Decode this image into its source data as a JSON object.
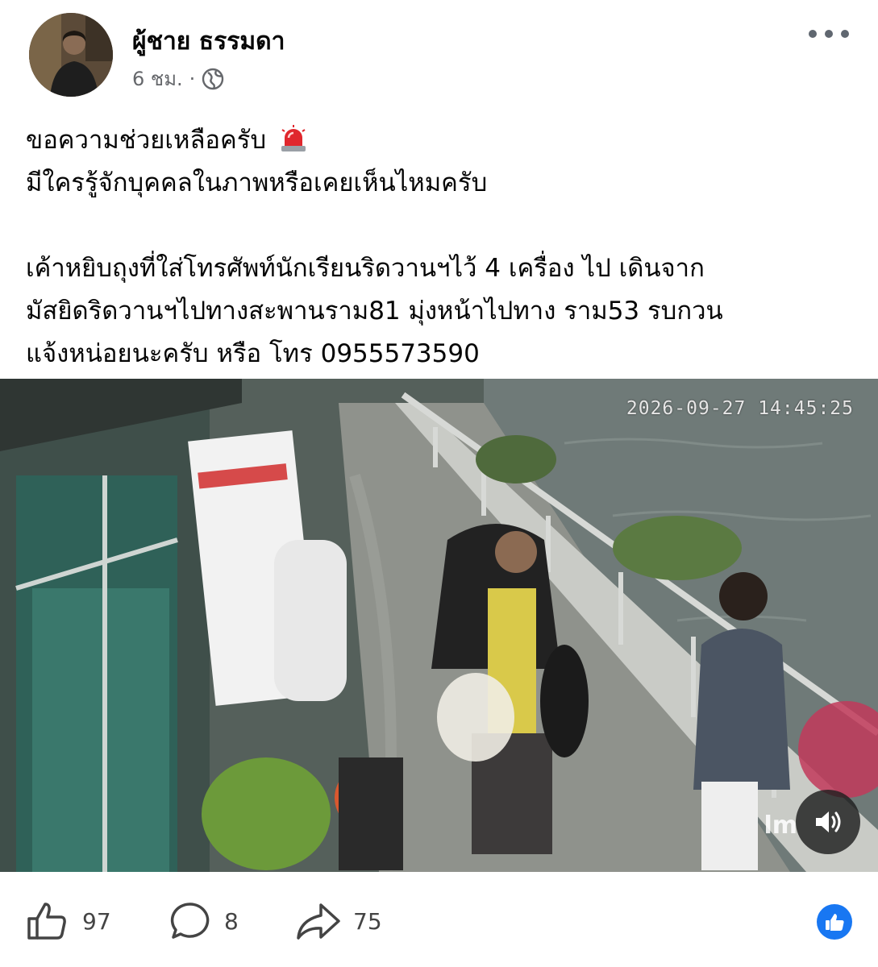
{
  "post": {
    "author": "ผู้ชาย ธรรมดา",
    "time": "6 ชม.",
    "separator": "·",
    "text_lines": [
      "ขอความช่วยเหลือครับ",
      "มีใครรู้จักบุคคลในภาพหรือเคยเห็นไหมครับ",
      "เค้าหยิบถุงที่ใส่โทรศัพท์นักเรียนริดวานฯไว้ 4 เครื่อง ไป เดินจาก",
      "มัสยิดริดวานฯไปทางสะพานราม81 มุ่งหน้าไปทาง ราม53 รบกวน",
      "แจ้งหน่อยนะครับ หรือ โทร 0955573590"
    ]
  },
  "media": {
    "timestamp": "2026-09-27 14:45:25",
    "watermark": "lm"
  },
  "actions": {
    "likes": "97",
    "comments": "8",
    "shares": "75"
  },
  "colors": {
    "reaction_blue": "#1877f2",
    "text_dark": "#050505",
    "text_muted": "#65676b",
    "siren_red": "#e0272d"
  }
}
